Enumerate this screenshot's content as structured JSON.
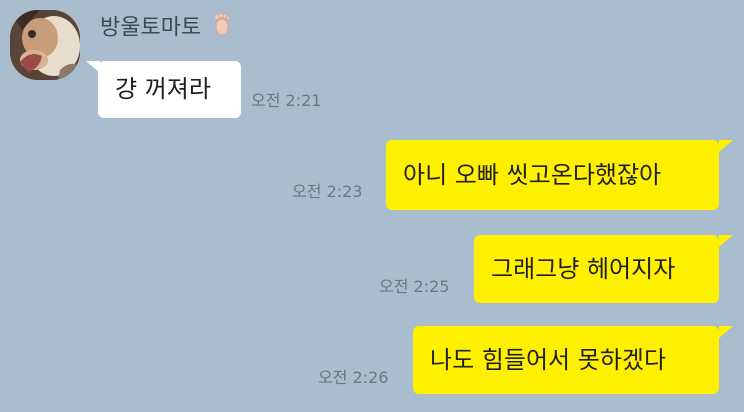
{
  "chat": {
    "sender_name": "방울토마토",
    "messages": [
      {
        "direction": "incoming",
        "text": "걍 꺼져라",
        "time": "오전 2:21"
      },
      {
        "direction": "outgoing",
        "text": "아니 오빠 씻고온다했잖아",
        "time": "오전 2:23"
      },
      {
        "direction": "outgoing",
        "text": "그래그냥 헤어지자",
        "time": "오전 2:25"
      },
      {
        "direction": "outgoing",
        "text": "나도 힘들어서 못하겠다",
        "time": "오전 2:26"
      }
    ]
  },
  "colors": {
    "background": "#a9bdce",
    "incoming_bubble": "#ffffff",
    "outgoing_bubble": "#fff000",
    "timestamp": "#6a7784"
  },
  "icons": {
    "sender_badge": "foot-icon",
    "avatar": "profile-photo"
  }
}
